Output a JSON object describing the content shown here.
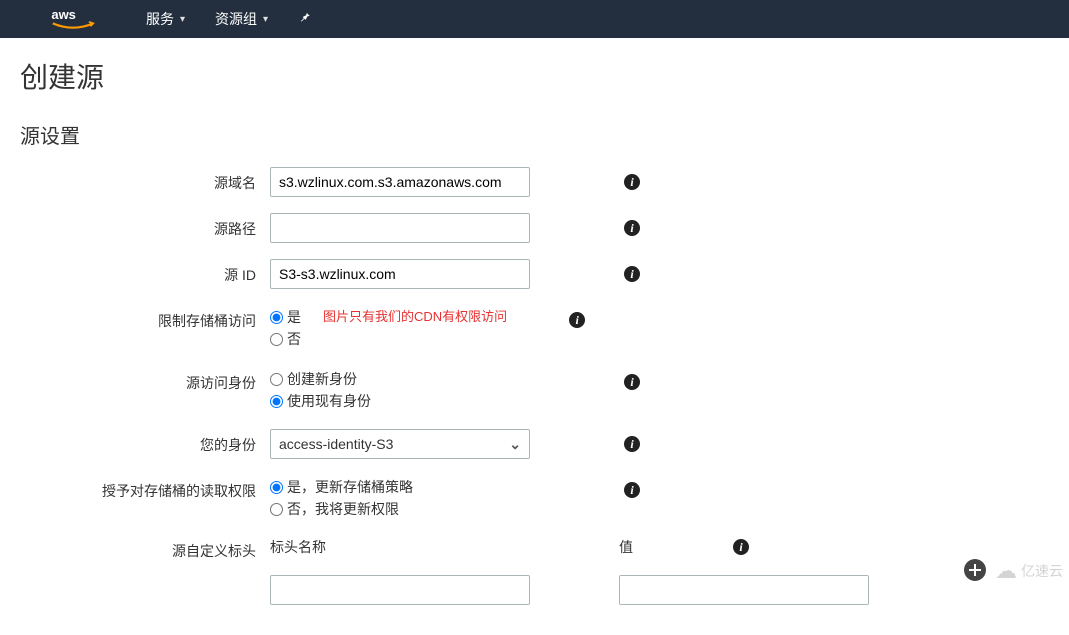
{
  "nav": {
    "services": "服务",
    "resource_groups": "资源组"
  },
  "page": {
    "title": "创建源",
    "section": "源设置"
  },
  "form": {
    "origin_domain": {
      "label": "源域名",
      "value": "s3.wzlinux.com.s3.amazonaws.com"
    },
    "origin_path": {
      "label": "源路径",
      "value": ""
    },
    "origin_id": {
      "label": "源 ID",
      "value": "S3-s3.wzlinux.com"
    },
    "restrict_bucket": {
      "label": "限制存储桶访问",
      "yes": "是",
      "no": "否",
      "note": "图片只有我们的CDN有权限访问"
    },
    "origin_access_identity": {
      "label": "源访问身份",
      "create": "创建新身份",
      "use_existing": "使用现有身份"
    },
    "your_identity": {
      "label": "您的身份",
      "value": "access-identity-S3"
    },
    "grant_read": {
      "label": "授予对存储桶的读取权限",
      "yes": "是，更新存储桶策略",
      "no": "否，我将更新权限"
    },
    "custom_headers": {
      "label": "源自定义标头",
      "name_label": "标头名称",
      "value_label": "值"
    }
  },
  "watermark": "亿速云"
}
